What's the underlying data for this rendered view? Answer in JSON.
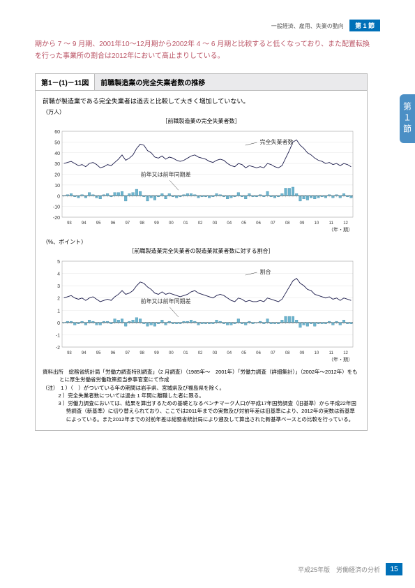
{
  "header": {
    "breadcrumb": "一般経済、雇用、失業の動向",
    "badge": "第 1 節"
  },
  "side_tab": "第１節",
  "body_text": "期から 7 ～ 9 月期、2001年10～12月期から2002年 4 ～ 6 月期と比較すると低くなっており、また配置転換を行った事業所の割合は2012年において高止まりしている。",
  "figure": {
    "number": "第1－(1)－11図",
    "title": "前職製造業の完全失業者数の推移",
    "caption": "前職が製造業である完全失業者は過去と比較して大きく増加していない。"
  },
  "chart_data": [
    {
      "type": "line+bar",
      "title": "［前職製造業の完全失業者数］",
      "y_unit": "（万人）",
      "ylim": [
        -20,
        60
      ],
      "yticks": [
        -20,
        -10,
        0,
        10,
        20,
        30,
        40,
        50,
        60
      ],
      "x_unit": "（年・期）",
      "xticks_years": [
        1993,
        1994,
        1995,
        1996,
        1997,
        1998,
        1999,
        2000,
        2001,
        2002,
        2003,
        2004,
        2005,
        2006,
        2007,
        2008,
        2009,
        2010,
        2011,
        2012
      ],
      "series": [
        {
          "name": "完全失業者数",
          "type": "line",
          "values": [
            30,
            31,
            32,
            30,
            28,
            29,
            27,
            30,
            31,
            29,
            26,
            27,
            29,
            28,
            31,
            34,
            38,
            33,
            35,
            38,
            44,
            48,
            47,
            42,
            40,
            36,
            35,
            37,
            34,
            36,
            35,
            33,
            32,
            33,
            35,
            37,
            38,
            36,
            35,
            34,
            32,
            31,
            33,
            34,
            33,
            30,
            28,
            27,
            30,
            29,
            26,
            28,
            27,
            26,
            27,
            26,
            30,
            29,
            27,
            26,
            28,
            35,
            42,
            50,
            52,
            47,
            44,
            40,
            38,
            35,
            33,
            32,
            30,
            31,
            29,
            30,
            28,
            30,
            29,
            27
          ]
        },
        {
          "name": "前年又は前年同期差",
          "type": "bar",
          "values": [
            0,
            1,
            2,
            -1,
            -2,
            1,
            -2,
            3,
            1,
            -2,
            -3,
            1,
            2,
            -1,
            3,
            3,
            4,
            -5,
            2,
            3,
            6,
            4,
            -1,
            -5,
            -2,
            -4,
            -1,
            2,
            -3,
            2,
            -1,
            -2,
            -1,
            1,
            2,
            2,
            1,
            -2,
            -1,
            -1,
            -2,
            -1,
            2,
            1,
            -1,
            -3,
            -2,
            -1,
            3,
            -1,
            -3,
            2,
            -1,
            -1,
            1,
            -1,
            4,
            -1,
            -2,
            -1,
            2,
            7,
            7,
            8,
            2,
            -5,
            -3,
            -4,
            -2,
            -3,
            -2,
            -1,
            -2,
            1,
            -2,
            1,
            -2,
            2,
            -1,
            -2
          ]
        }
      ],
      "annotations": [
        "完全失業者数",
        "前年又は前年同期差"
      ]
    },
    {
      "type": "line+bar",
      "title": "［前職製造業完全失業者の製造業就業者数に対する割合］",
      "y_unit": "（%、ポイント）",
      "ylim": [
        -2,
        5
      ],
      "yticks": [
        -2,
        -1,
        0,
        1,
        2,
        3,
        4,
        5
      ],
      "x_unit": "（年・期）",
      "series": [
        {
          "name": "割合",
          "type": "line",
          "values": [
            2.0,
            2.1,
            2.2,
            2.0,
            1.9,
            2.0,
            1.8,
            2.0,
            2.1,
            1.9,
            1.7,
            1.8,
            1.9,
            1.8,
            2.1,
            2.3,
            2.6,
            2.3,
            2.4,
            2.6,
            3.0,
            3.3,
            3.2,
            2.9,
            2.7,
            2.4,
            2.3,
            2.5,
            2.3,
            2.4,
            2.3,
            2.2,
            2.1,
            2.2,
            2.3,
            2.5,
            2.6,
            2.4,
            2.3,
            2.2,
            2.1,
            2.0,
            2.2,
            2.3,
            2.2,
            2.0,
            1.8,
            1.7,
            2.0,
            1.9,
            1.7,
            1.8,
            1.7,
            1.7,
            1.8,
            1.7,
            2.0,
            1.9,
            1.8,
            1.7,
            1.9,
            2.4,
            2.9,
            3.4,
            3.6,
            3.2,
            3.0,
            2.7,
            2.6,
            2.3,
            2.2,
            2.1,
            2.0,
            2.1,
            1.9,
            2.0,
            1.8,
            2.0,
            1.9,
            1.8
          ]
        },
        {
          "name": "前年又は前年同期差",
          "type": "bar",
          "values": [
            0,
            0.1,
            0.1,
            -0.2,
            -0.1,
            0.1,
            -0.2,
            0.2,
            0.1,
            -0.2,
            -0.2,
            0.1,
            0.1,
            -0.1,
            0.3,
            0.2,
            0.3,
            -0.3,
            0.1,
            0.2,
            0.4,
            0.3,
            -0.1,
            -0.3,
            -0.2,
            -0.3,
            -0.1,
            0.2,
            -0.2,
            0.1,
            -0.1,
            -0.1,
            -0.1,
            0.1,
            0.1,
            0.2,
            0.1,
            -0.2,
            -0.1,
            -0.1,
            -0.1,
            -0.1,
            0.2,
            0.1,
            -0.1,
            -0.2,
            -0.2,
            -0.1,
            0.3,
            -0.1,
            -0.2,
            0.1,
            -0.1,
            0,
            0.1,
            -0.1,
            0.3,
            -0.1,
            -0.1,
            -0.1,
            0.2,
            0.5,
            0.5,
            0.5,
            0.2,
            -0.4,
            -0.2,
            -0.3,
            -0.1,
            -0.3,
            -0.1,
            -0.1,
            -0.1,
            0.1,
            -0.2,
            0.1,
            -0.2,
            0.2,
            -0.1,
            -0.1
          ]
        }
      ],
      "annotations": [
        "割合",
        "前年又は前年同期差"
      ]
    }
  ],
  "notes": {
    "source": "資料出所　総務省統計局「労働力調査特別調査」（2 月調査）（1985年～　2001年）「労働力調査（詳細集計）」（2002年～2012年）をもとに厚生労働省労働政策担当参事官室にて作成",
    "items": [
      "（注）　1 ）（　）がついている年の期間は岩手県、宮城県及び福島県を除く。",
      "2 ）完全失業者数については過去 1 年間に離職した者に限る。",
      "3 ）労働力調査においては、結果を算出するための基礎となるベンチマーク人口が平成17年国勢調査（旧基準）から平成22年国勢調査（新基準）に切り替えられており、ここでは2011年までの実数及び対前年差は旧基準により、2012年の実数は新基準によっている。また2012年までの対前年差は総務省統計局により遡及して算出された新基準ベースとの比較を行っている。"
    ]
  },
  "footer": {
    "text": "平成25年版　労働経済の分析",
    "page": "15"
  }
}
